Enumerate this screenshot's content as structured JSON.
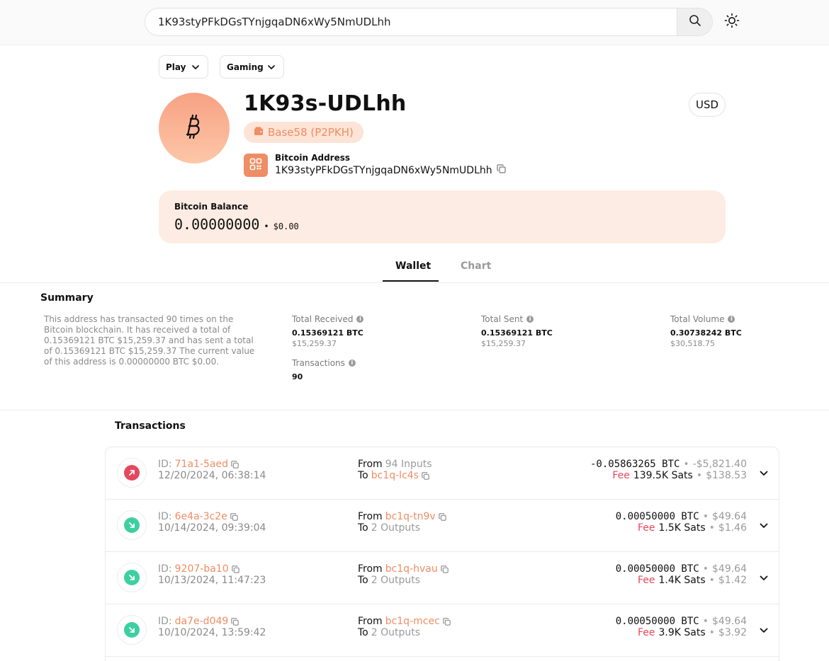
{
  "search": {
    "value": "1K93styPFkDGsTYnjgqaDN6xWy5NmUDLhh"
  },
  "selectors": {
    "play": "Play",
    "gaming": "Gaming"
  },
  "header": {
    "short_address": "1K93s-UDLhh",
    "type_badge": "Base58 (P2PKH)",
    "address_label": "Bitcoin Address",
    "address_full": "1K93styPFkDGsTYnjgqaDN6xWy5NmUDLhh",
    "currency": "USD"
  },
  "balance": {
    "label": "Bitcoin Balance",
    "btc": "0.00000000",
    "separator": "•",
    "usd": "$0.00"
  },
  "tabs": [
    {
      "label": "Wallet"
    },
    {
      "label": "Chart"
    }
  ],
  "summary": {
    "title": "Summary",
    "text": "This address has transacted 90 times on the Bitcoin blockchain. It has received a total of 0.15369121 BTC $15,259.37 and has sent a total of 0.15369121 BTC $15,259.37 The current value of this address is 0.00000000 BTC $0.00.",
    "stats": [
      {
        "label": "Total Received",
        "value": "0.15369121 BTC",
        "sub": "$15,259.37"
      },
      {
        "label": "Total Sent",
        "value": "0.15369121 BTC",
        "sub": "$15,259.37"
      },
      {
        "label": "Total Volume",
        "value": "0.30738242 BTC",
        "sub": "$30,518.75"
      },
      {
        "label": "Transactions",
        "value": "90",
        "sub": ""
      }
    ],
    "info_glyph": "i"
  },
  "transactions": {
    "title": "Transactions",
    "id_label": "ID:",
    "from_label": "From",
    "to_label": "To",
    "fee_label": "Fee",
    "bullet": "•",
    "colors": {
      "sent": "#e5485d",
      "received": "#3ecfa0",
      "accent": "#ef8d64"
    },
    "rows": [
      {
        "direction": "sent",
        "id": "71a1-5aed",
        "date": "12/20/2024, 06:38:14",
        "from": "94 Inputs",
        "from_is_link": false,
        "to": "bc1q-lc4s",
        "to_is_link": true,
        "amount": "-0.05863265 BTC",
        "amount_usd": "-$5,821.40",
        "fee": "139.5K Sats",
        "fee_usd": "$138.53"
      },
      {
        "direction": "received",
        "id": "6e4a-3c2e",
        "date": "10/14/2024, 09:39:04",
        "from": "bc1q-tn9v",
        "from_is_link": true,
        "to": "2 Outputs",
        "to_is_link": false,
        "amount": "0.00050000 BTC",
        "amount_usd": "$49.64",
        "fee": "1.5K Sats",
        "fee_usd": "$1.46"
      },
      {
        "direction": "received",
        "id": "9207-ba10",
        "date": "10/13/2024, 11:47:23",
        "from": "bc1q-hvau",
        "from_is_link": true,
        "to": "2 Outputs",
        "to_is_link": false,
        "amount": "0.00050000 BTC",
        "amount_usd": "$49.64",
        "fee": "1.4K Sats",
        "fee_usd": "$1.42"
      },
      {
        "direction": "received",
        "id": "da7e-d049",
        "date": "10/10/2024, 13:59:42",
        "from": "bc1q-mcec",
        "from_is_link": true,
        "to": "2 Outputs",
        "to_is_link": false,
        "amount": "0.00050000 BTC",
        "amount_usd": "$49.64",
        "fee": "3.9K Sats",
        "fee_usd": "$3.92"
      }
    ]
  },
  "icons": {
    "search": "search-icon",
    "theme": "sun-icon",
    "coin": "bitcoin-icon",
    "wallet": "wallet-icon",
    "qr": "qr-code-icon",
    "copy": "copy-icon",
    "chevron": "chevron-down-icon",
    "sent": "arrow-up-right-icon",
    "received": "arrow-down-right-icon"
  }
}
